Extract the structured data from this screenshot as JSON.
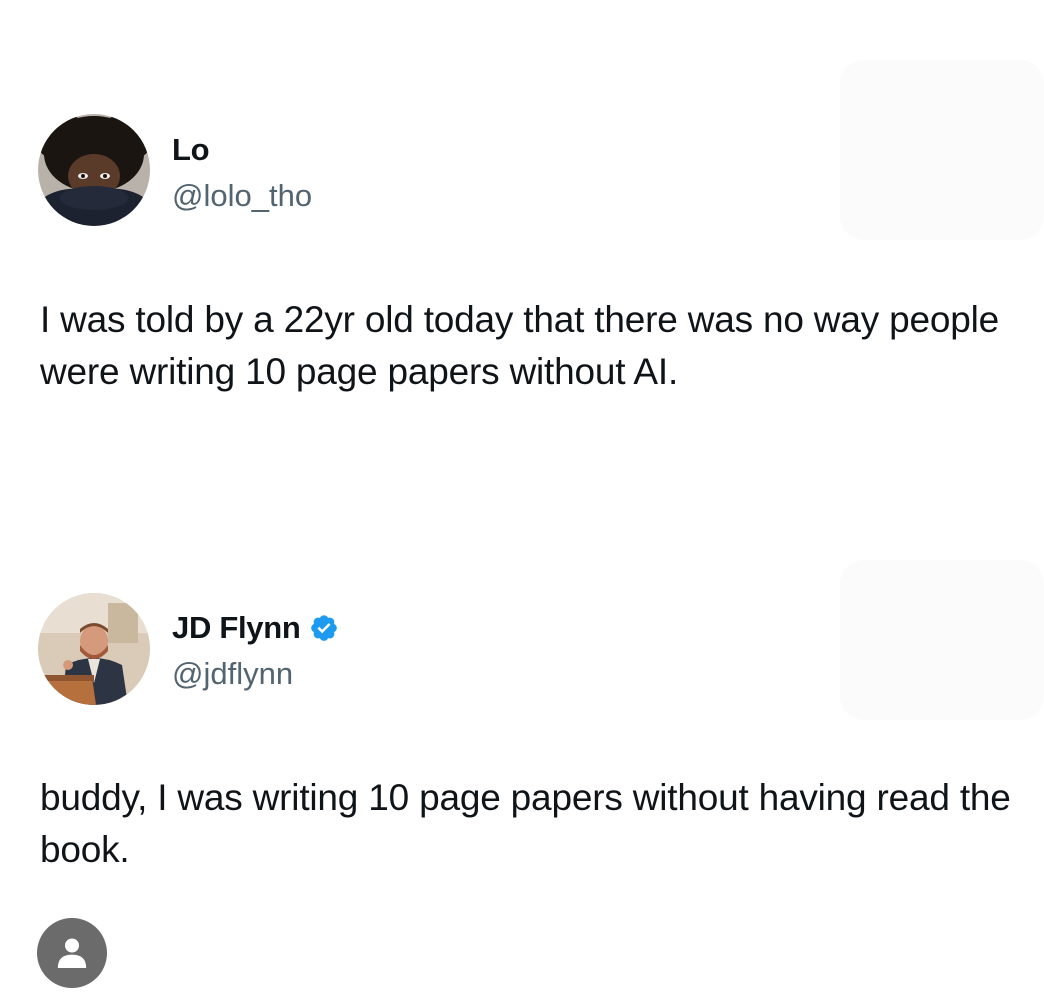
{
  "tweets": [
    {
      "display_name": "Lo",
      "handle": "@lolo_tho",
      "verified": false,
      "text": "I was told by a 22yr old today that there was no way people were writing 10 page papers without AI.",
      "avatar_icon": "avatar-photo"
    },
    {
      "display_name": "JD Flynn",
      "handle": "@jdflynn",
      "verified": true,
      "text": "buddy, I was writing 10 page papers without having read the book.",
      "avatar_icon": "avatar-photo"
    }
  ],
  "profile_button": {
    "icon": "user-icon"
  },
  "colors": {
    "text": "#0f1419",
    "secondary": "#536471",
    "verified": "#1d9bf0",
    "fab": "#6b6b6b"
  }
}
